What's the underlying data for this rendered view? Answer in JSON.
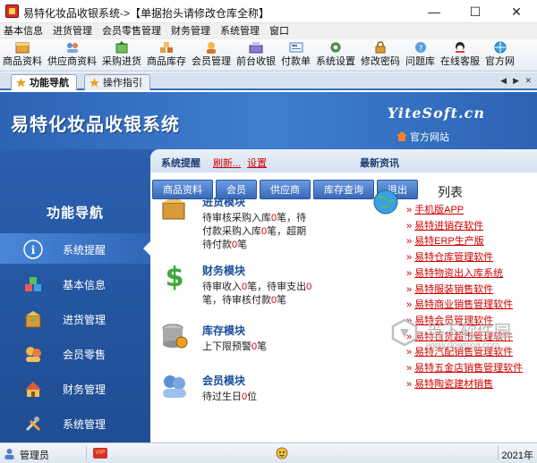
{
  "window": {
    "title": "易特化妆品收银系统->【单据抬头请修改仓库全称】",
    "min_glyph": "—",
    "max_glyph": "☐",
    "close_glyph": "✕"
  },
  "menubar": {
    "items": [
      "基本信息",
      "进货管理",
      "会员零售管理",
      "财务管理",
      "系统管理",
      "窗口"
    ]
  },
  "toolbar": {
    "items": [
      {
        "label": "商品资料",
        "icon": "product-icon"
      },
      {
        "label": "供应商资料",
        "icon": "supplier-icon"
      },
      {
        "label": "采购进货",
        "icon": "purchase-icon"
      },
      {
        "label": "商品库存",
        "icon": "inventory-icon"
      },
      {
        "label": "会员管理",
        "icon": "member-icon"
      },
      {
        "label": "前台收银",
        "icon": "cashier-icon"
      },
      {
        "label": "付款单",
        "icon": "payment-icon"
      },
      {
        "label": "系统设置",
        "icon": "settings-icon"
      },
      {
        "label": "修改密码",
        "icon": "password-icon"
      },
      {
        "label": "问题库",
        "icon": "faq-icon"
      },
      {
        "label": "在线客服",
        "icon": "support-icon"
      },
      {
        "label": "官方网",
        "icon": "website-icon"
      }
    ]
  },
  "tabs": {
    "active": "功能导航",
    "second": "操作指引",
    "controls": [
      "◀",
      "▶",
      "✕"
    ]
  },
  "banner": {
    "title": "易特化妆品收银系统",
    "brand": "YiteSoft.cn",
    "official_link": "官方网站"
  },
  "sidebar": {
    "heading": "功能导航",
    "items": [
      {
        "label": "系统提醒",
        "icon": "info-icon",
        "active": true
      },
      {
        "label": "基本信息",
        "icon": "boxes-icon",
        "active": false
      },
      {
        "label": "进货管理",
        "icon": "package-icon",
        "active": false
      },
      {
        "label": "会员零售",
        "icon": "members-icon",
        "active": false
      },
      {
        "label": "财务管理",
        "icon": "finance-icon",
        "active": false
      },
      {
        "label": "系统管理",
        "icon": "tools-icon",
        "active": false
      }
    ]
  },
  "panel": {
    "reminder_label": "系统提醒",
    "refresh": "刷新...",
    "settings": "设置",
    "news_label": "最新资讯",
    "buttons": [
      "商品资料",
      "会员",
      "供应商",
      "库存查询",
      "退出"
    ],
    "modules": [
      {
        "title": "进货模块",
        "icon": "purchase-module-icon",
        "parts": [
          "待审核采购入库",
          "0",
          "笔，待付款采购入库",
          "0",
          "笔，超期待付款",
          "0",
          "笔"
        ]
      },
      {
        "title": "财务模块",
        "icon": "finance-module-icon",
        "parts": [
          "待审收入",
          "0",
          "笔，待审支出",
          "0",
          "笔，待审核付款",
          "0",
          "笔"
        ]
      },
      {
        "title": "库存模块",
        "icon": "inventory-module-icon",
        "parts": [
          "上下限预警",
          "0",
          "笔"
        ]
      },
      {
        "title": "会员模块",
        "icon": "member-module-icon",
        "parts": [
          "待过生日",
          "0",
          "位"
        ]
      }
    ],
    "news_heading": "列表",
    "news": [
      "手机版APP",
      "易特进销存软件",
      "易特ERP生产版",
      "易特仓库管理软件",
      "易特物资出入库系统",
      "易特服装销售软件",
      "易特商业销售管理软件",
      "易特会员管理软件",
      "易特百货超市管理软件",
      "易特汽配销售管理软件",
      "易特五金店销售管理软件",
      "易特陶瓷建材销售"
    ]
  },
  "watermark": {
    "main": "当下软件园",
    "sub": "www.downxia.com"
  },
  "statusbar": {
    "user": "管理员",
    "vip": "VIP",
    "year": "2021年"
  }
}
